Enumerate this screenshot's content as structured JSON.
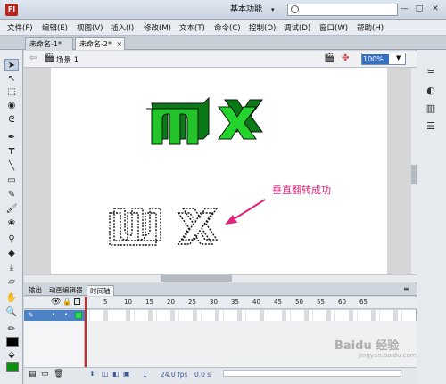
{
  "app": {
    "logo": "Fl",
    "workspace": "基本功能",
    "workspace_caret": "▾",
    "search_placeholder": ""
  },
  "window_buttons": [
    "—",
    "□",
    "✕"
  ],
  "menu": [
    "文件(F)",
    "编辑(E)",
    "视图(V)",
    "插入(I)",
    "修改(M)",
    "文本(T)",
    "命令(C)",
    "控制(O)",
    "调试(D)",
    "窗口(W)",
    "帮助(H)"
  ],
  "tabs": [
    {
      "label": "未命名-1*",
      "close": "×"
    },
    {
      "label": "未命名-2*",
      "close": "×"
    }
  ],
  "scene": {
    "label": "场景 1",
    "zoom": "100%"
  },
  "stage": {
    "text_top": "m x",
    "text_bottom": "w x",
    "colors": {
      "letter_dark": "#0a7a16",
      "letter_light": "#22d42c",
      "outline": "#111111",
      "annotation": "#e0227b"
    }
  },
  "annotation": "垂直翻转成功",
  "timeline": {
    "tabs": [
      "输出",
      "动画编辑器",
      "时间轴"
    ],
    "frame_numbers": [
      "5",
      "10",
      "15",
      "20",
      "25",
      "30",
      "35",
      "40",
      "45",
      "50",
      "55",
      "60",
      "65"
    ],
    "status": {
      "frame": "1",
      "fps": "24.0 fps",
      "time": "0.0 s"
    }
  },
  "watermark": {
    "main": "Baidu 经验",
    "sub": "jingyan.baidu.com"
  }
}
